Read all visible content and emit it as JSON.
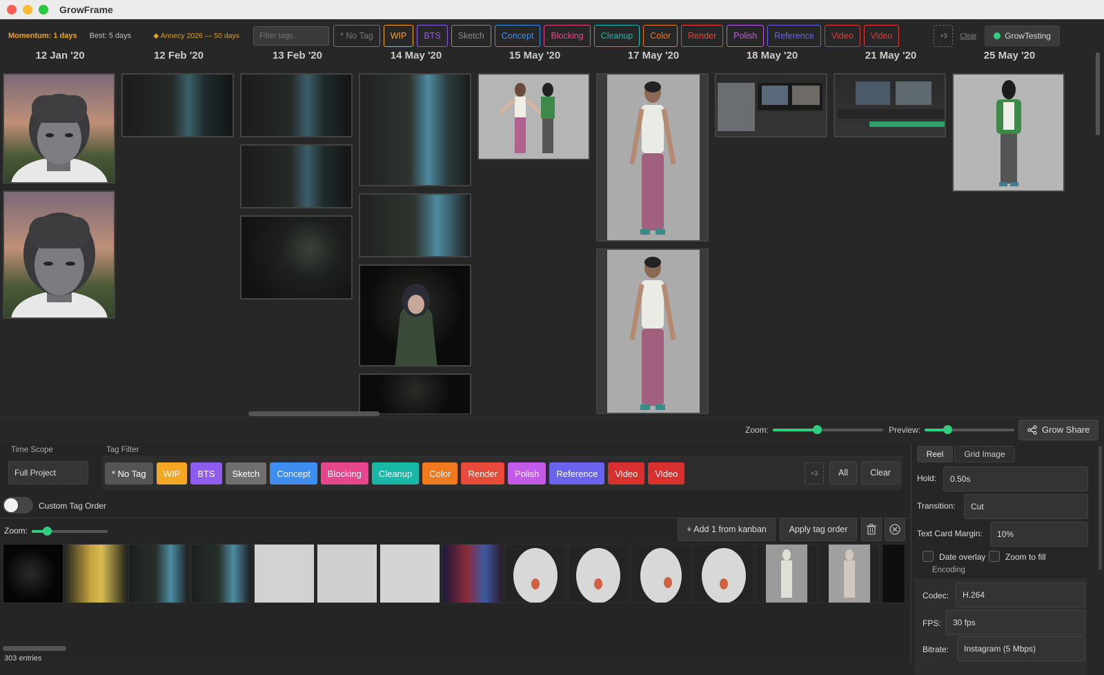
{
  "app": {
    "title": "GrowFrame"
  },
  "topbar": {
    "momentum": "Momentum: 1 days",
    "best": "Best: 5 days",
    "deadline": "◆ Annecy 2026 — 50 days",
    "filter_placeholder": "Filter tags...",
    "tags": [
      {
        "label": "* No Tag",
        "color": "#777777"
      },
      {
        "label": "WIP",
        "color": "#f5a623"
      },
      {
        "label": "BTS",
        "color": "#8e5cf0"
      },
      {
        "label": "Sketch",
        "color": "#8a8a8a"
      },
      {
        "label": "Concept",
        "color": "#3d8ef0"
      },
      {
        "label": "Blocking",
        "color": "#e8468c"
      },
      {
        "label": "Cleanup",
        "color": "#17b8a6"
      },
      {
        "label": "Color",
        "color": "#f07a1d"
      },
      {
        "label": "Render",
        "color": "#e94a3a"
      },
      {
        "label": "Polish",
        "color": "#c45ae8"
      },
      {
        "label": "Reference",
        "color": "#6a63f0"
      },
      {
        "label": "Video",
        "color": "#e03a3a"
      },
      {
        "label": "Video",
        "color": "#e03a3a"
      }
    ],
    "more": "+3",
    "clear": "Clear",
    "account": "GrowTesting"
  },
  "board": {
    "columns": [
      {
        "date": "12 Jan '20"
      },
      {
        "date": "12 Feb '20"
      },
      {
        "date": "13 Feb '20"
      },
      {
        "date": "14 May '20"
      },
      {
        "date": "15 May '20"
      },
      {
        "date": "17 May '20"
      },
      {
        "date": "18 May '20"
      },
      {
        "date": "21 May '20"
      },
      {
        "date": "25 May '20"
      }
    ]
  },
  "midbar": {
    "zoom_label": "Zoom:",
    "zoom_level": 0.4,
    "preview_label": "Preview:",
    "preview_level": 0.25,
    "share_label": "Grow Share"
  },
  "bottom": {
    "time_scope_label": "Time Scope",
    "time_scope_value": "Full Project",
    "tag_filter_label": "Tag Filter",
    "tags": [
      {
        "label": "* No Tag",
        "color": "#555555"
      },
      {
        "label": "WIP",
        "color": "#f5a623"
      },
      {
        "label": "BTS",
        "color": "#8e5cf0"
      },
      {
        "label": "Sketch",
        "color": "#6f6f6f"
      },
      {
        "label": "Concept",
        "color": "#3d8ef0"
      },
      {
        "label": "Blocking",
        "color": "#e8468c"
      },
      {
        "label": "Cleanup",
        "color": "#17b8a6"
      },
      {
        "label": "Color",
        "color": "#f07a1d"
      },
      {
        "label": "Render",
        "color": "#e94a3a"
      },
      {
        "label": "Polish",
        "color": "#c45ae8"
      },
      {
        "label": "Reference",
        "color": "#6a63f0"
      },
      {
        "label": "Video",
        "color": "#d8302f"
      },
      {
        "label": "Video",
        "color": "#d8302f"
      }
    ],
    "more": "+3",
    "all_label": "All",
    "clear_label": "Clear",
    "custom_order_label": "Custom Tag Order",
    "zoom_label": "Zoom:",
    "zoom_level": 0.2,
    "add_kanban_label": "+ Add 1 from kanban",
    "apply_order_label": "Apply tag order",
    "entries": "303 entries"
  },
  "panel": {
    "tabs": [
      "Reel",
      "Grid Image"
    ],
    "hold_label": "Hold:",
    "hold_value": "0.50s",
    "transition_label": "Transition:",
    "transition_value": "Cut",
    "margin_label": "Text Card Margin:",
    "margin_value": "10%",
    "date_overlay_label": "Date overlay",
    "zoom_fill_label": "Zoom to fill",
    "encoding_label": "Encoding",
    "codec_label": "Codec:",
    "codec_value": "H.264",
    "fps_label": "FPS:",
    "fps_value": "30 fps",
    "bitrate_label": "Bitrate:",
    "bitrate_value": "Instagram (5 Mbps)"
  }
}
